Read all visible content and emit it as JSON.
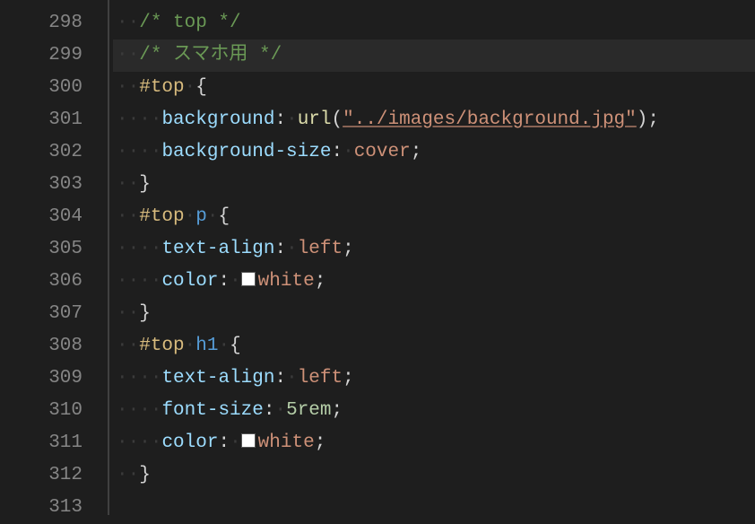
{
  "lineNumbers": [
    "298",
    "299",
    "300",
    "301",
    "302",
    "303",
    "304",
    "305",
    "306",
    "307",
    "308",
    "309",
    "310",
    "311",
    "312",
    "313"
  ],
  "highlightIndex": 1,
  "code": {
    "comment_top": "/* top */",
    "comment_sp": "/* スマホ用 */",
    "sel_top": "#top",
    "brace_open": "{",
    "brace_close": "}",
    "prop_background": "background",
    "func_url": "url",
    "str_bg": "\"../images/background.jpg\"",
    "prop_bgsize": "background-size",
    "val_cover": "cover",
    "sel_top_p_p": "p",
    "prop_textalign": "text-align",
    "val_left": "left",
    "prop_color": "color",
    "val_white": "white",
    "sel_top_h1_h1": "h1",
    "prop_fontsize": "font-size",
    "val_5": "5",
    "val_rem": "rem",
    "colon": ":",
    "semicolon": ";",
    "paren_open": "(",
    "paren_close": ")",
    "dot": "·"
  }
}
